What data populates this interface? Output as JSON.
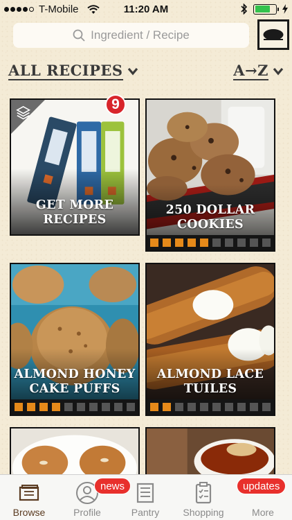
{
  "status": {
    "carrier": "T-Mobile",
    "time": "11:20 AM",
    "signal_bars_filled": 4,
    "signal_bars_total": 5,
    "battery_level": 0.75,
    "battery_color": "#33c24d"
  },
  "search": {
    "placeholder": "Ingredient / Recipe"
  },
  "filter": {
    "category_label": "ALL RECIPES",
    "sort_label": "A→Z"
  },
  "promo_badge": "9",
  "cards": [
    {
      "title": "GET MORE RECIPES",
      "rating_filled": null
    },
    {
      "title": "250 DOLLAR COOKIES",
      "rating_filled": 5,
      "rating_total": 10
    },
    {
      "title": "ALMOND HONEY CAKE PUFFS",
      "rating_filled": 4,
      "rating_total": 10
    },
    {
      "title": "ALMOND LACE TUILES",
      "rating_filled": 2,
      "rating_total": 10
    }
  ],
  "tabs": [
    {
      "label": "Browse",
      "icon": "browse-icon",
      "active": true
    },
    {
      "label": "Profile",
      "icon": "profile-icon",
      "badge": "news"
    },
    {
      "label": "Pantry",
      "icon": "pantry-icon"
    },
    {
      "label": "Shopping",
      "icon": "shopping-icon"
    },
    {
      "label": "More",
      "icon": "more-icon",
      "badge": "updates"
    }
  ],
  "colors": {
    "accent_orange": "#e68a1a",
    "badge_red": "#e8302c",
    "active_tab": "#5a3a20"
  }
}
